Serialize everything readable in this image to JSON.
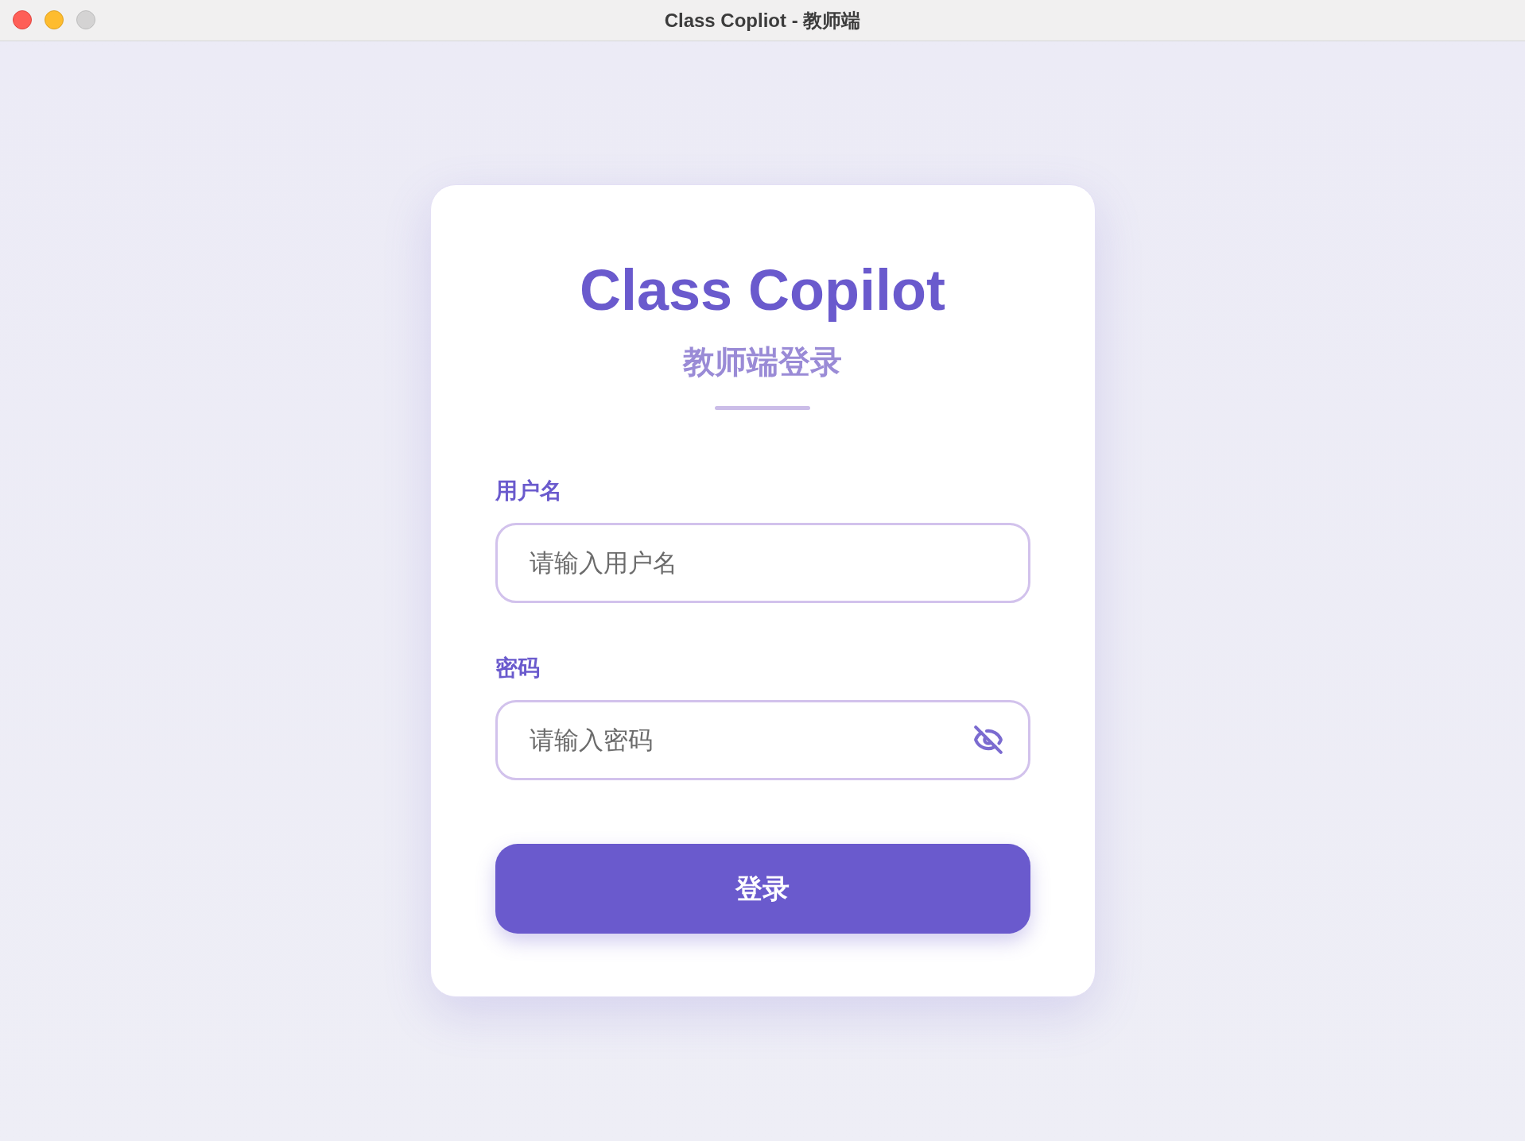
{
  "window": {
    "title": "Class Copliot - 教师端"
  },
  "login": {
    "title": "Class Copilot",
    "subtitle": "教师端登录",
    "username": {
      "label": "用户名",
      "placeholder": "请输入用户名"
    },
    "password": {
      "label": "密码",
      "placeholder": "请输入密码",
      "visible": false
    },
    "submit": "登录"
  }
}
